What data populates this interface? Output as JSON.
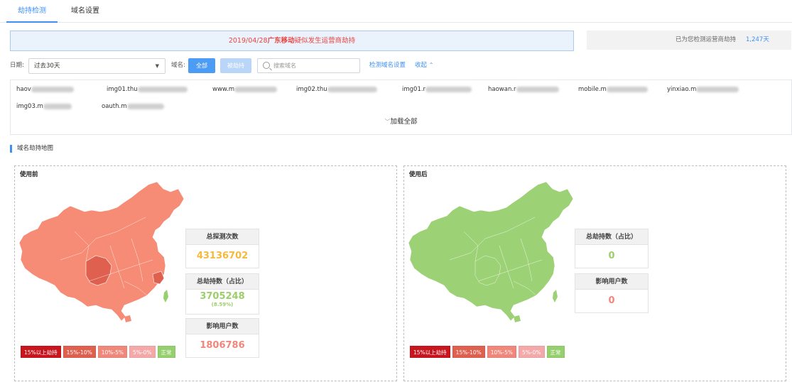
{
  "tabs": [
    {
      "label": "劫持检测",
      "active": true
    },
    {
      "label": "域名设置",
      "active": false
    }
  ],
  "alert": {
    "date": "2019/04/28",
    "isp": "广东移动",
    "message": "疑似发生运营商劫持"
  },
  "protect": {
    "label": "已为您检测运营商劫持",
    "days": "1,247天"
  },
  "filter": {
    "date_label": "日期:",
    "date_value": "过去30天",
    "domain_label": "域名:",
    "btn_all": "全部",
    "btn_hijacked": "被劫持",
    "search_placeholder": "搜索域名",
    "link_settings": "检测域名设置",
    "link_collapse": "收起"
  },
  "domains": {
    "row1": [
      "haov",
      "img01.thu",
      "www.m",
      "img02.thu",
      "img01.r",
      "haowan.r",
      "mobile.m",
      "yinxiao.m"
    ],
    "row2": [
      "img03.m",
      "oauth.m"
    ],
    "load_all": "加载全部"
  },
  "section_title": "域名劫持地图",
  "before": {
    "title": "使用前",
    "stats": {
      "probes_label": "总探测次数",
      "probes_value": "43136702",
      "hijack_label": "总劫持数（占比）",
      "hijack_value": "3705248",
      "hijack_pct": "(8.59%)",
      "users_label": "影响用户数",
      "users_value": "1806786"
    }
  },
  "after": {
    "title": "使用后",
    "stats": {
      "hijack_label": "总劫持数（占比）",
      "hijack_value": "0",
      "users_label": "影响用户数",
      "users_value": "0"
    }
  },
  "legend": [
    "15%以上劫持",
    "15%-10%",
    "10%-5%",
    "5%-0%",
    "正常"
  ],
  "colors": {
    "accent": "#3f8ff4",
    "legend": [
      "#c9151e",
      "#e0604f",
      "#f1867a",
      "#f4a9a8",
      "#96cf6d"
    ],
    "map_before": "#f68b76",
    "map_before_dark": "#e0604f",
    "map_after": "#9dd175",
    "probes_value": "#f6b93b",
    "hijack_value": "#9ccf6a",
    "users_value": "#f1867a"
  }
}
